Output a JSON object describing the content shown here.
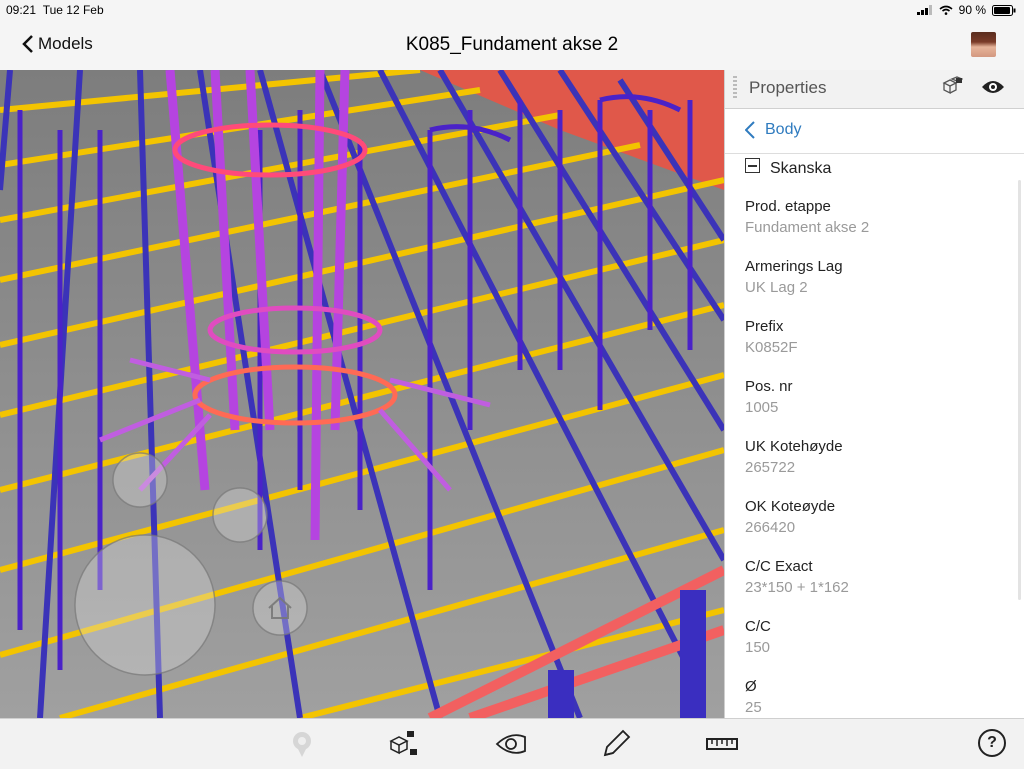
{
  "status": {
    "time": "09:21",
    "date": "Tue 12 Feb",
    "battery": "90 %"
  },
  "nav": {
    "back_label": "Models",
    "title": "K085_Fundament akse 2"
  },
  "properties": {
    "title": "Properties",
    "back_label": "Body",
    "group": "Skanska",
    "items": [
      {
        "key": "Prod. etappe",
        "value": "Fundament akse 2"
      },
      {
        "key": "Armerings Lag",
        "value": "UK Lag 2"
      },
      {
        "key": "Prefix",
        "value": "K0852F"
      },
      {
        "key": "Pos. nr",
        "value": "1005"
      },
      {
        "key": "UK Kotehøyde",
        "value": "265722"
      },
      {
        "key": "OK Koteøyde",
        "value": "266420"
      },
      {
        "key": "C/C Exact",
        "value": "23*150 + 1*162"
      },
      {
        "key": "C/C",
        "value": "150"
      },
      {
        "key": "Ø",
        "value": "25"
      }
    ]
  },
  "toolbar": {
    "items": [
      "pin-icon",
      "objects-icon",
      "eye-view-icon",
      "markup-pencil-icon",
      "measure-icon"
    ],
    "help": "?"
  }
}
